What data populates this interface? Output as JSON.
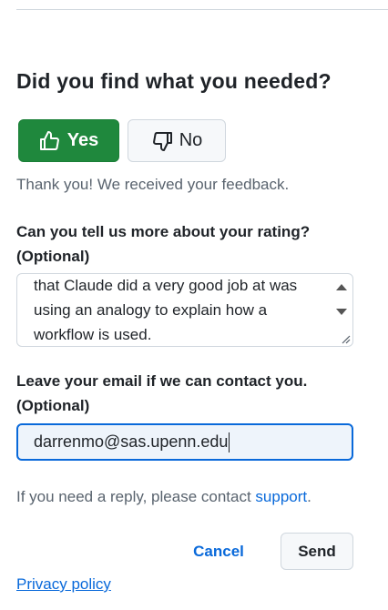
{
  "feedback": {
    "question": "Did you find what you needed?",
    "yes_label": "Yes",
    "no_label": "No",
    "thanks_message": "Thank you! We received your feedback.",
    "rating_label": "Can you tell us more about your rating?",
    "rating_optional": "(Optional)",
    "rating_text_lines": [
      "that Claude did a very good job at was",
      "using an analogy to explain how a",
      "workflow is used."
    ],
    "email_label": "Leave your email if we can contact you.",
    "email_optional": "(Optional)",
    "email_value": "darrenmo@sas.upenn.edu",
    "reply_prefix": "If you need a reply, please contact ",
    "reply_link": "support",
    "reply_suffix": ".",
    "cancel_label": "Cancel",
    "send_label": "Send",
    "privacy_label": "Privacy policy"
  },
  "colors": {
    "yes_button": "#1f883d",
    "link": "#0969da",
    "focus_border": "#0969da"
  }
}
